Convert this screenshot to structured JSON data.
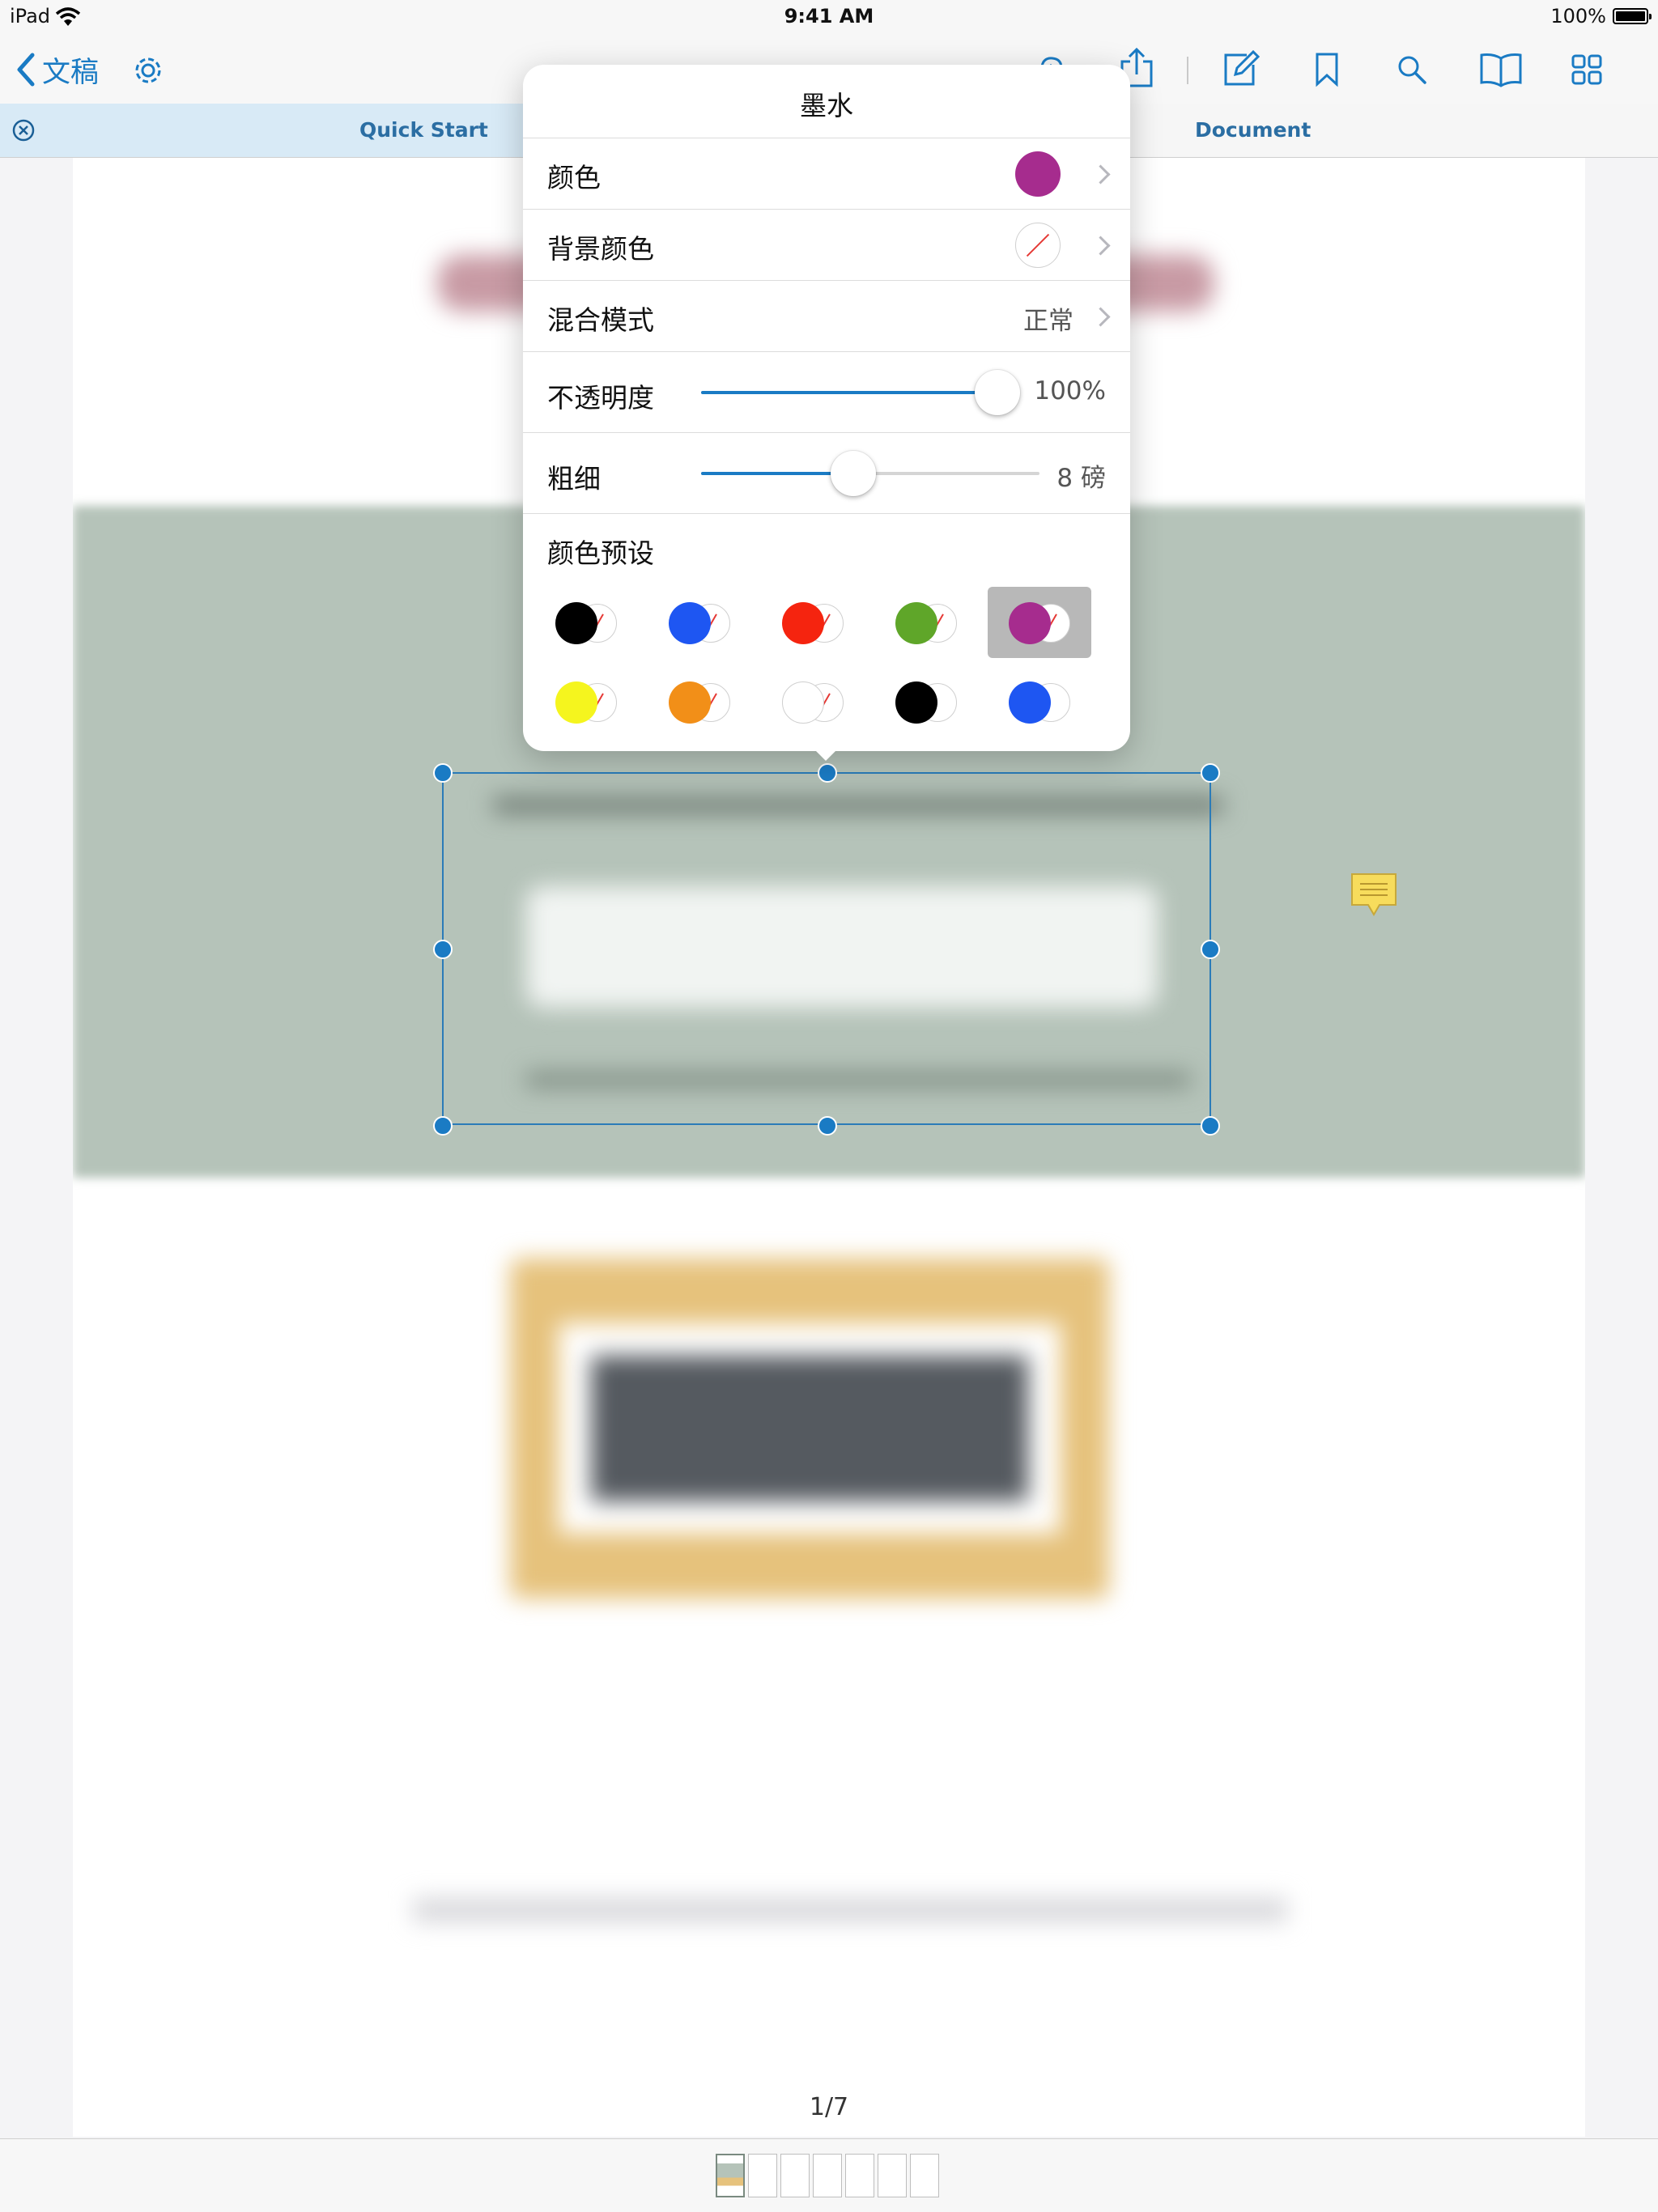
{
  "status_bar": {
    "device": "iPad",
    "time": "9:41 AM",
    "battery": "100%"
  },
  "nav": {
    "back_label": "文稿",
    "icons": [
      "chevron-left-icon",
      "gear-icon",
      "cloud-upload-icon",
      "share-icon",
      "edit-icon",
      "bookmark-icon",
      "search-icon",
      "book-icon",
      "grid-icon"
    ]
  },
  "tabs": [
    {
      "label": "Quick Start",
      "active": true
    },
    {
      "label": "Document",
      "active": false
    }
  ],
  "popover": {
    "title": "墨水",
    "color_label": "颜色",
    "color_value": "#a62c8e",
    "bg_color_label": "背景颜色",
    "blend_label": "混合模式",
    "blend_value": "正常",
    "opacity_label": "不透明度",
    "opacity_value": "100%",
    "opacity_fraction": 1.0,
    "thickness_label": "粗细",
    "thickness_value": "8 磅",
    "thickness_fraction": 0.45,
    "presets_label": "颜色预设",
    "presets": [
      {
        "fg": "#000000",
        "bg": "none",
        "selected": false
      },
      {
        "fg": "#1e56f2",
        "bg": "none",
        "selected": false
      },
      {
        "fg": "#f5240f",
        "bg": "none",
        "selected": false
      },
      {
        "fg": "#5fa629",
        "bg": "none",
        "selected": false
      },
      {
        "fg": "#a62c8e",
        "bg": "none",
        "selected": true
      },
      {
        "fg": "#f5f51e",
        "bg": "none",
        "selected": false
      },
      {
        "fg": "#f28f18",
        "bg": "none",
        "selected": false
      },
      {
        "fg": "#ffffff",
        "bg": "none",
        "selected": false
      },
      {
        "fg": "#000000",
        "bg": "#ffffff",
        "selected": false
      },
      {
        "fg": "#1e56f2",
        "bg": "#ffffff",
        "selected": false
      }
    ]
  },
  "page_indicator": "1/7",
  "page_count": 7,
  "colors": {
    "accent": "#1a7bc4",
    "note": "#f7dc5c"
  }
}
